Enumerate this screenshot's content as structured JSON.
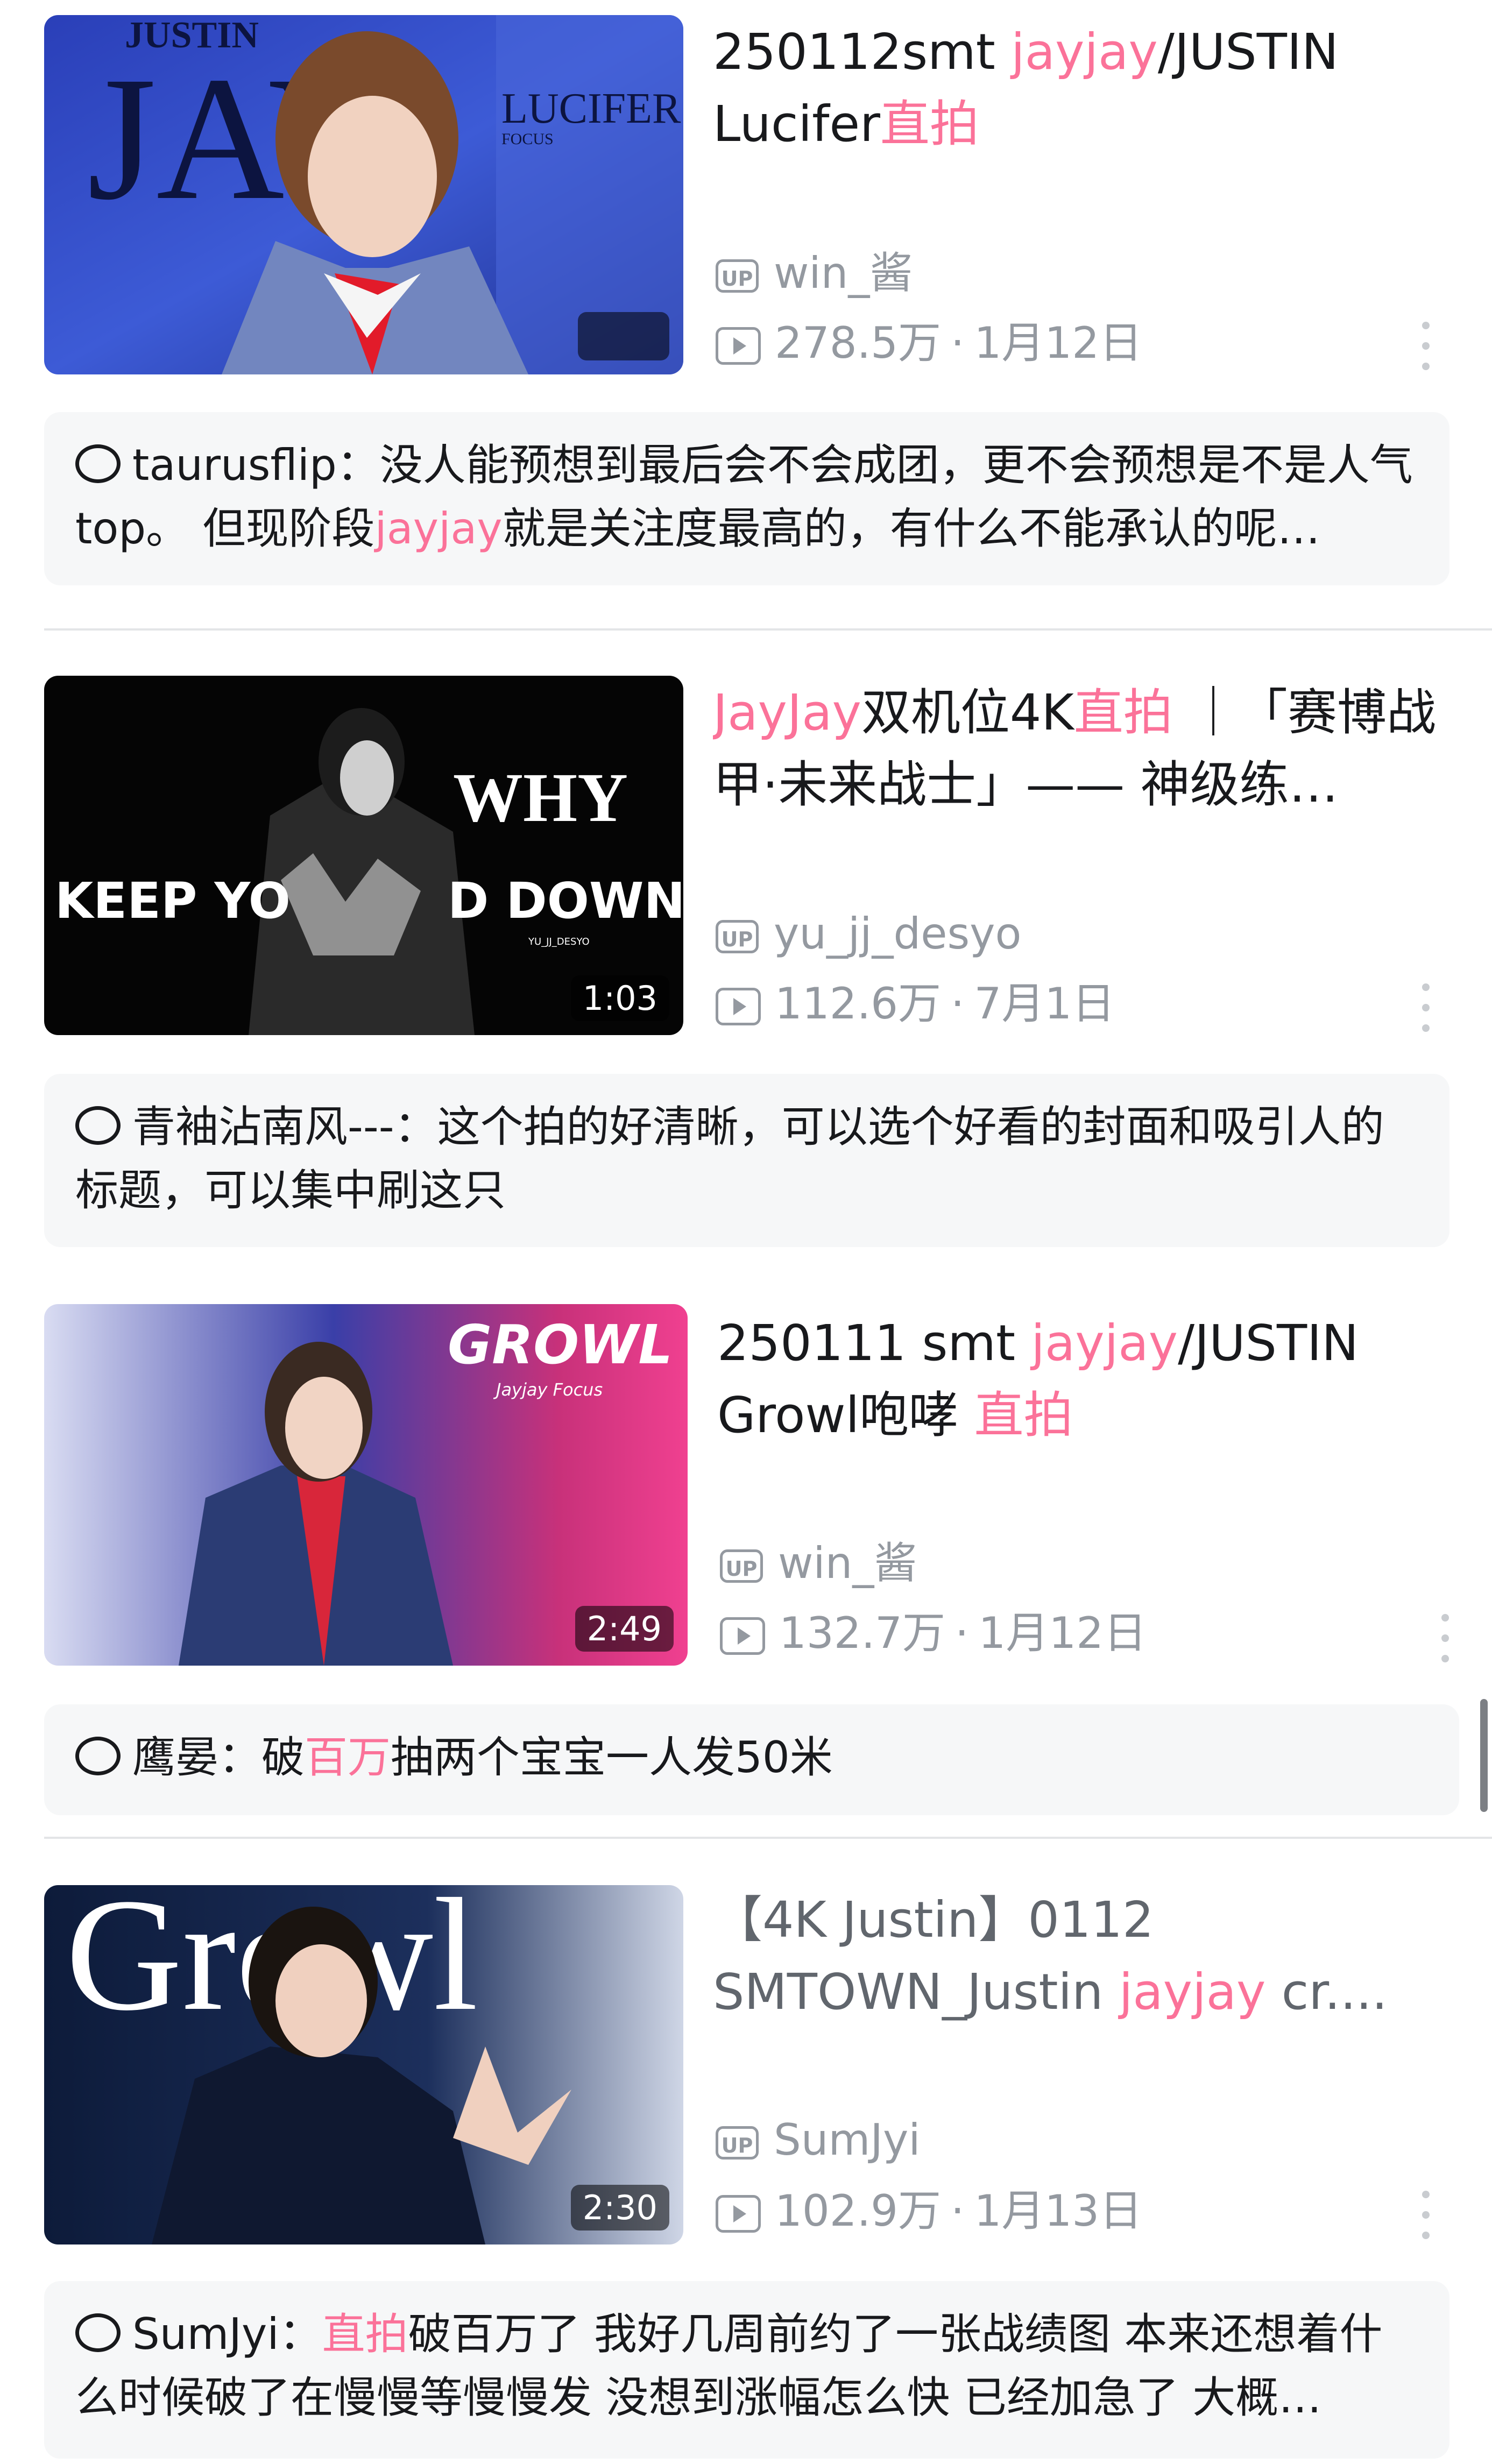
{
  "feed": [
    {
      "title_parts": [
        "250112smt ",
        "jayjay",
        "/JUSTIN Lucifer",
        "直拍"
      ],
      "uploader": "win_酱",
      "views": "278.5万",
      "date": "1月12日",
      "duration": "",
      "thumb_text": [
        "JUSTIN",
        "JAY",
        "LUCIFER",
        "FOCUS"
      ],
      "comment_user": "taurusflip：",
      "comment_parts": [
        "没人能预想到最后会不会成团，更不会预想是不是人气top。 但现阶段",
        "jayjay",
        "就是关注度最高的，有什么不能承认的呢…"
      ]
    },
    {
      "title_parts": [
        "JayJay",
        "双机位4K",
        "直拍",
        " ｜「赛博战甲·未来战士」—— 神级练…"
      ],
      "uploader": "yu_jj_desyo",
      "views": "112.6万",
      "date": "7月1日",
      "duration": "1:03",
      "thumb_text": [
        "WHY",
        "KEEP YO",
        "D DOWN",
        "YU_JJ_DESYO"
      ],
      "comment_user": "青袖沾南风---：",
      "comment_parts": [
        "这个拍的好清晰，可以选个好看的封面和吸引人的标题，可以集中刷这只"
      ]
    },
    {
      "title_parts": [
        "250111 smt ",
        "jayjay",
        "/JUSTIN Growl咆哮 ",
        "直拍"
      ],
      "uploader": "win_酱",
      "views": "132.7万",
      "date": "1月12日",
      "duration": "2:49",
      "thumb_text": [
        "GROWL",
        "Jayjay Focus"
      ],
      "comment_user": "鹰晏：",
      "comment_parts": [
        "破",
        "百万",
        "抽两个宝宝一人发50米"
      ]
    },
    {
      "title_parts": [
        "【4K Justin】0112 SMTOWN_Justin ",
        "jayjay",
        " cr...."
      ],
      "uploader": "SumJyi",
      "views": "102.9万",
      "date": "1月13日",
      "duration": "2:30",
      "thumb_text": [
        "Growl"
      ],
      "comment_user": "SumJyi：",
      "comment_parts": [
        "直拍",
        "破百万了  我好几周前约了一张战绩图 本来还想着什么时候破了在慢慢等慢慢发 没想到涨幅怎么快 已经加急了 大概…"
      ]
    }
  ],
  "labels": {
    "uploader_badge": "UP"
  },
  "colors": {
    "highlight": "#fb7299",
    "meta_gray": "#9499a0",
    "card_bg": "#f6f7f8"
  }
}
